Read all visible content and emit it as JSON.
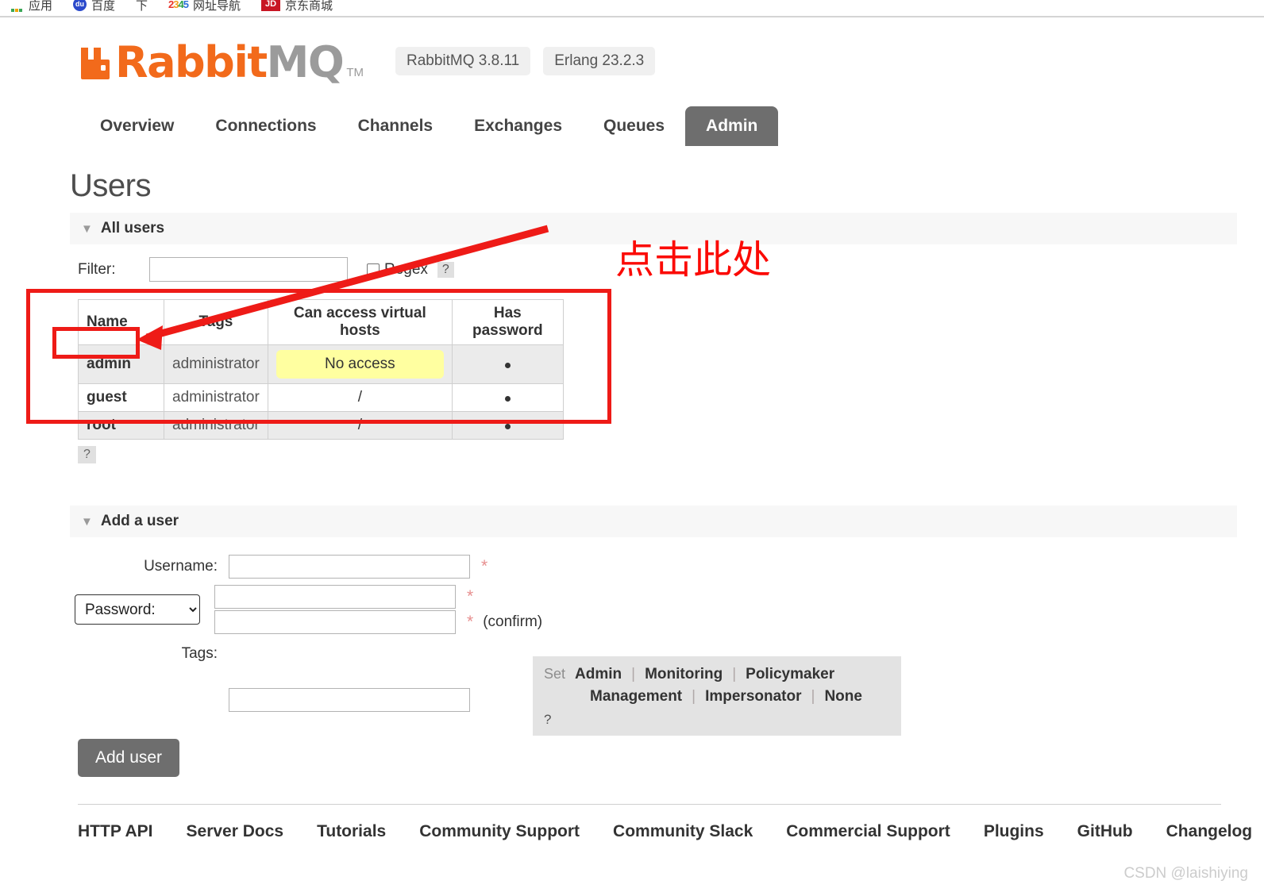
{
  "browser": {
    "bookmarks": [
      {
        "label": "应用",
        "icon": "apps-grid-icon"
      },
      {
        "label": "百度",
        "icon": "baidu-icon"
      },
      {
        "label": "下",
        "icon": "none"
      },
      {
        "label": "网址导航",
        "icon": "2345-icon"
      },
      {
        "label": "京东商城",
        "icon": "jd-icon"
      }
    ]
  },
  "header": {
    "logo_rabbit": "Rabbit",
    "logo_mq": "MQ",
    "logo_tm": "TM",
    "badges": [
      "RabbitMQ 3.8.11",
      "Erlang 23.2.3"
    ]
  },
  "nav": {
    "tabs": [
      {
        "label": "Overview",
        "active": false
      },
      {
        "label": "Connections",
        "active": false
      },
      {
        "label": "Channels",
        "active": false
      },
      {
        "label": "Exchanges",
        "active": false
      },
      {
        "label": "Queues",
        "active": false
      },
      {
        "label": "Admin",
        "active": true
      }
    ]
  },
  "page": {
    "title": "Users"
  },
  "all_users": {
    "section_label": "All users",
    "caret": "▼",
    "filter_label": "Filter:",
    "filter_value": "",
    "regex_label": "Regex",
    "help_mark": "?",
    "table": {
      "columns": [
        "Name",
        "Tags",
        "Can access virtual hosts",
        "Has password"
      ],
      "rows": [
        {
          "name": "admin",
          "tags": "administrator",
          "vhosts": "No access",
          "vhosts_highlight": true,
          "has_password": "●"
        },
        {
          "name": "guest",
          "tags": "administrator",
          "vhosts": "/",
          "vhosts_highlight": false,
          "has_password": "●"
        },
        {
          "name": "root",
          "tags": "administrator",
          "vhosts": "/",
          "vhosts_highlight": false,
          "has_password": "●"
        }
      ]
    },
    "table_help_mark": "?"
  },
  "add_user": {
    "section_label": "Add a user",
    "caret": "▼",
    "username_label": "Username:",
    "username_value": "",
    "password_select_value": "Password:",
    "password_value": "",
    "password_confirm_value": "",
    "confirm_note": "(confirm)",
    "required_mark": "*",
    "tags_label": "Tags:",
    "tags_value": "",
    "set_word": "Set",
    "tag_options_line1": [
      "Admin",
      "Monitoring",
      "Policymaker"
    ],
    "tag_options_line2": [
      "Management",
      "Impersonator",
      "None"
    ],
    "separator": "|",
    "panel_help_mark": "?",
    "submit_label": "Add user"
  },
  "footer": {
    "links": [
      "HTTP API",
      "Server Docs",
      "Tutorials",
      "Community Support",
      "Community Slack",
      "Commercial Support",
      "Plugins",
      "GitHub",
      "Changelog"
    ]
  },
  "annotation": {
    "text": "点击此处",
    "color": "#fb0a05"
  },
  "watermark": {
    "text": "CSDN @laishiying"
  }
}
